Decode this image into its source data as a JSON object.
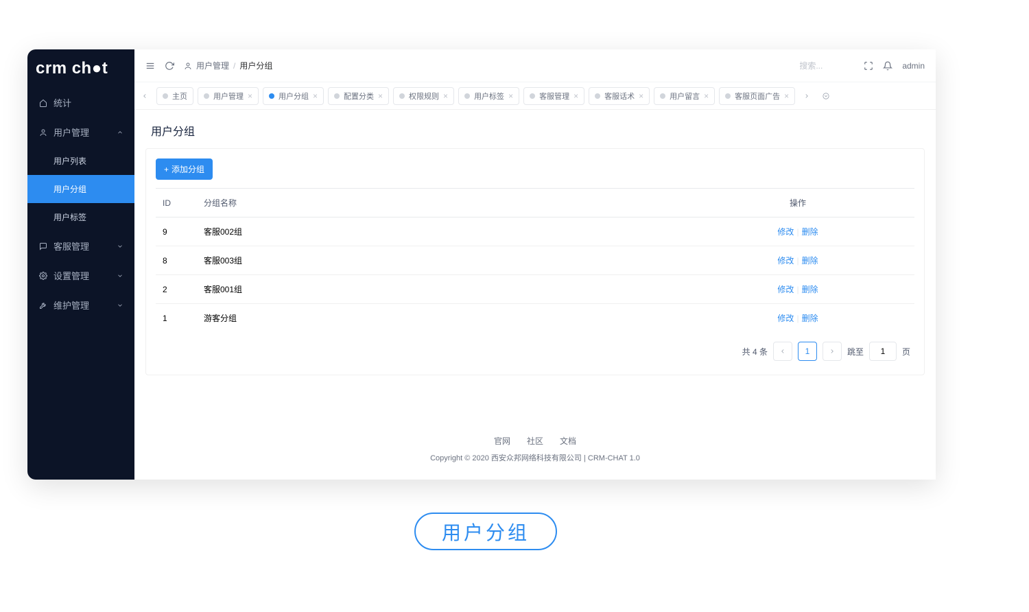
{
  "logo": "crm chat",
  "sidebar": {
    "items": [
      {
        "label": "统计",
        "icon": "home"
      },
      {
        "label": "用户管理",
        "icon": "user",
        "expanded": true,
        "children": [
          {
            "label": "用户列表"
          },
          {
            "label": "用户分组",
            "active": true
          },
          {
            "label": "用户标签"
          }
        ]
      },
      {
        "label": "客服管理",
        "icon": "chat"
      },
      {
        "label": "设置管理",
        "icon": "gear"
      },
      {
        "label": "维护管理",
        "icon": "wrench"
      }
    ]
  },
  "topbar": {
    "breadcrumb": {
      "parent": "用户管理",
      "current": "用户分组"
    },
    "search_placeholder": "搜索...",
    "user": "admin"
  },
  "tabs": [
    {
      "label": "主页"
    },
    {
      "label": "用户管理"
    },
    {
      "label": "用户分组",
      "active": true
    },
    {
      "label": "配置分类"
    },
    {
      "label": "权限规则"
    },
    {
      "label": "用户标签"
    },
    {
      "label": "客服管理"
    },
    {
      "label": "客服话术"
    },
    {
      "label": "用户留言"
    },
    {
      "label": "客服页面广告"
    }
  ],
  "page": {
    "title": "用户分组",
    "add_button": "添加分组",
    "columns": {
      "id": "ID",
      "name": "分组名称",
      "op": "操作"
    },
    "actions": {
      "edit": "修改",
      "delete": "删除"
    },
    "rows": [
      {
        "id": "9",
        "name": "客服002组"
      },
      {
        "id": "8",
        "name": "客服003组"
      },
      {
        "id": "2",
        "name": "客服001组"
      },
      {
        "id": "1",
        "name": "游客分组"
      }
    ]
  },
  "pagination": {
    "total_text": "共 4 条",
    "current": "1",
    "goto_label": "跳至",
    "goto_value": "1",
    "page_suffix": "页"
  },
  "footer": {
    "links": [
      "官网",
      "社区",
      "文档"
    ],
    "copyright": "Copyright © 2020 西安众邦网络科技有限公司 | CRM-CHAT 1.0"
  },
  "floating_tag": "用户分组"
}
